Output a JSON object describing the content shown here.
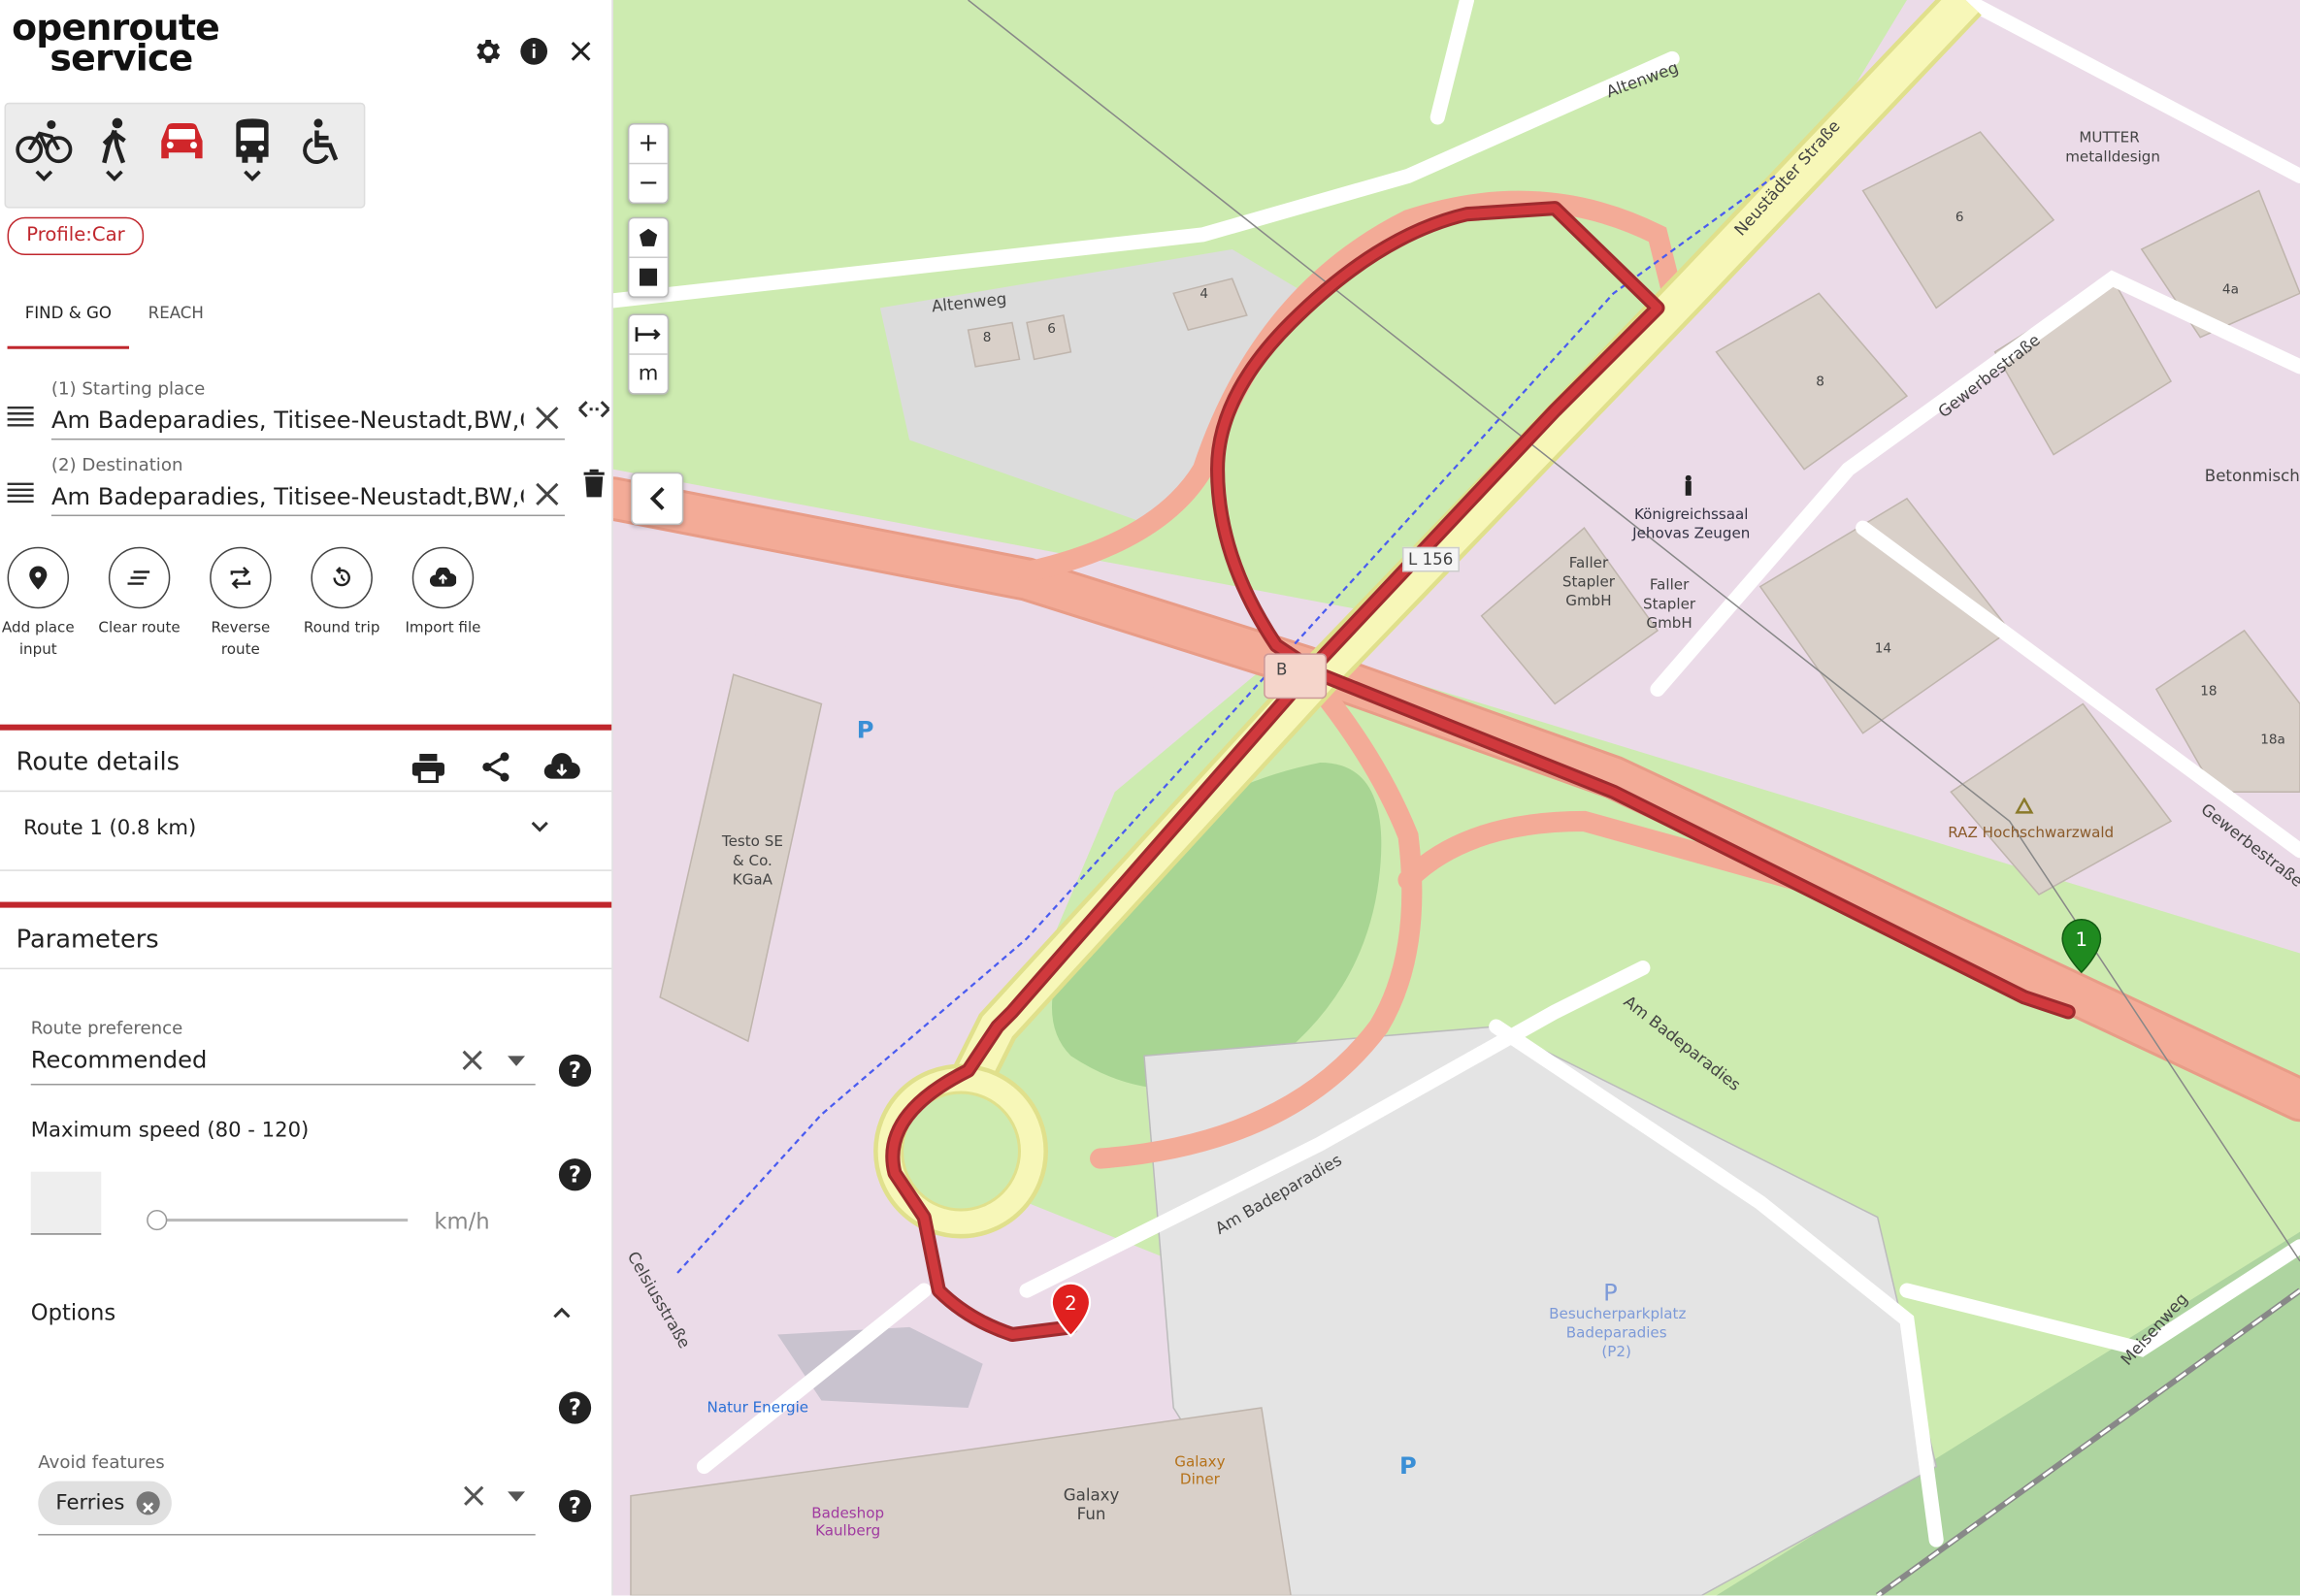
{
  "app": {
    "logo_line1": "openroute",
    "logo_line2": "service"
  },
  "profile_chip": "Profile:Car",
  "tabs": [
    {
      "label": "FIND & GO",
      "active": true
    },
    {
      "label": "REACH",
      "active": false
    }
  ],
  "places": [
    {
      "label": "(1) Starting place",
      "value": "Am Badeparadies, Titisee-Neustadt,BW,Germany"
    },
    {
      "label": "(2) Destination",
      "value": "Am Badeparadies, Titisee-Neustadt,BW,Germany"
    }
  ],
  "actions": [
    {
      "label": "Add place input",
      "icon": "pin-icon"
    },
    {
      "label": "Clear route",
      "icon": "clear-icon"
    },
    {
      "label": "Reverse route",
      "icon": "reverse-icon"
    },
    {
      "label": "Round trip",
      "icon": "round-trip-icon"
    },
    {
      "label": "Import file",
      "icon": "upload-icon"
    }
  ],
  "route_details": {
    "title": "Route details",
    "route_label": "Route 1 (0.8 km)"
  },
  "parameters": {
    "title": "Parameters",
    "route_preference_label": "Route preference",
    "route_preference_value": "Recommended",
    "max_speed_label": "Maximum speed (80 - 120)",
    "max_speed_value": "",
    "speed_unit": "km/h",
    "options_label": "Options",
    "avoid_features_label": "Avoid features",
    "avoid_features": [
      "Ferries"
    ]
  },
  "map": {
    "zoom_in": "+",
    "zoom_out": "−",
    "measure_unit": "m",
    "markers": [
      "1",
      "2"
    ],
    "labels": {
      "altenweg1": "Altenweg",
      "altenweg2": "Altenweg",
      "neustaedter": "Neustädter Straße",
      "gewerbe1": "Gewerbestraße",
      "gewerbe2": "Gewerbestraße",
      "mutter": "MUTTER metalldesign",
      "beton": "Betonmisch",
      "kingdom": "Königreichssaal Jehovas Zeugen",
      "faller1": "Faller Stapler GmbH",
      "faller2": "Faller Stapler GmbH",
      "raz": "RAZ Hochschwarzwald",
      "testo": "Testo SE & Co. KGaA",
      "badeparadies1": "Am Badeparadies",
      "badeparadies2": "Am Badeparadies",
      "meisenweg": "Meisenweg",
      "besucher": "Besucherparkplatz Badeparadies (P2)",
      "natur": "Natur Energie",
      "galaxy_diner": "Galaxy Diner",
      "galaxy_fun": "Galaxy Fun",
      "badeshop": "Badeshop Kaulberg",
      "celsius": "Celsiusstraße",
      "l156": "L 156",
      "b_shield": "B",
      "n4": "4",
      "n6a": "6",
      "n8a": "8",
      "n6b": "6",
      "n8b": "8",
      "n4a": "4a",
      "n14": "14",
      "n18": "18",
      "n18a": "18a",
      "p1": "P",
      "p2": "P",
      "p3": "P"
    }
  },
  "colors": {
    "accent": "#c0272d",
    "route": "#c8383c",
    "marker_start": "#1f8a1f",
    "marker_end": "#e0201f"
  }
}
